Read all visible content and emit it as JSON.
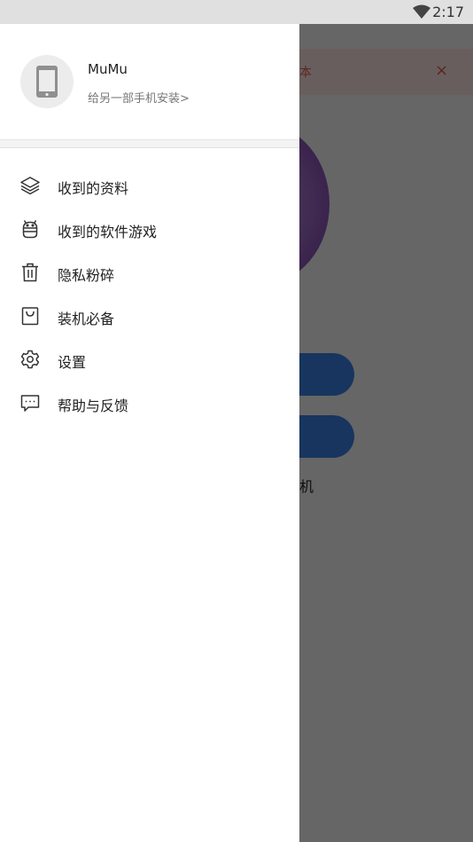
{
  "status_bar": {
    "time": "2:17"
  },
  "background": {
    "banner_text": "本",
    "close_glyph": "×",
    "bottom_text": "机"
  },
  "drawer": {
    "profile": {
      "name": "MuMu",
      "install_link": "给另一部手机安装>",
      "avatar_icon": "phone-icon"
    },
    "menu": [
      {
        "label": "收到的资料",
        "icon": "layers-icon"
      },
      {
        "label": "收到的软件游戏",
        "icon": "android-icon"
      },
      {
        "label": "隐私粉碎",
        "icon": "trash-icon"
      },
      {
        "label": "装机必备",
        "icon": "shopping-bag-icon"
      },
      {
        "label": "设置",
        "icon": "gear-icon"
      },
      {
        "label": "帮助与反馈",
        "icon": "chat-bubble-icon"
      }
    ]
  }
}
